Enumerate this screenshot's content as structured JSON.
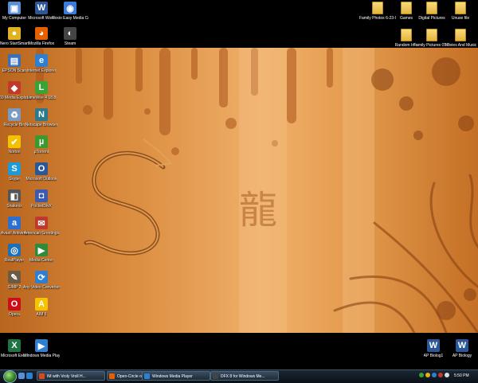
{
  "desktop": {
    "top_left_icons": [
      {
        "label": "My Computer",
        "icon": "computer-icon",
        "color": "#5a8fd6",
        "glyph": "▣"
      },
      {
        "label": "Microsoft Word",
        "icon": "word-icon",
        "color": "#2b5797",
        "glyph": "W"
      },
      {
        "label": "Roxio Easy Media Crea...",
        "icon": "roxio-icon",
        "color": "#3e7bd8",
        "glyph": "◉"
      },
      {
        "label": "Nero StartSmart",
        "icon": "nero-icon",
        "color": "#e1b21f",
        "glyph": "●"
      },
      {
        "label": "Mozilla Firefox",
        "icon": "firefox-icon",
        "color": "#e66000",
        "glyph": "◕"
      },
      {
        "label": "Steam",
        "icon": "steam-icon",
        "color": "#444444",
        "glyph": "◐"
      }
    ],
    "top_right_icons": [
      {
        "label": "Family Photos 6-23-07",
        "icon": "folder-icon"
      },
      {
        "label": "Games",
        "icon": "folder-icon"
      },
      {
        "label": "Digital Pictures",
        "icon": "folder-icon"
      },
      {
        "label": "Unuse file",
        "icon": "folder-icon"
      },
      {
        "label": "Random Info",
        "icon": "folder-icon"
      },
      {
        "label": "Family Pictures 07-08",
        "icon": "folder-icon"
      },
      {
        "label": "Movies And Music",
        "icon": "folder-icon"
      }
    ],
    "left_column_icons": [
      {
        "label": "EPSON Scan",
        "icon": "epson-icon",
        "color": "#3b6fb6",
        "glyph": "▤"
      },
      {
        "label": "Internet Explorer",
        "icon": "ie-icon",
        "color": "#2f7fd1",
        "glyph": "e"
      },
      {
        "label": "360 Media Explorer",
        "icon": "media-explorer-icon",
        "color": "#c0392b",
        "glyph": "◆"
      },
      {
        "label": "LimeWire 4.18.8",
        "icon": "limewire-icon",
        "color": "#3aa335",
        "glyph": "L"
      },
      {
        "label": "Recycle Bin",
        "icon": "recycle-bin-icon",
        "color": "#7a9bbf",
        "glyph": "♻"
      },
      {
        "label": "Netscape Browser",
        "icon": "netscape-icon",
        "color": "#2c7a8c",
        "glyph": "N"
      },
      {
        "label": "Norton",
        "icon": "norton-icon",
        "color": "#f2c200",
        "glyph": "✔"
      },
      {
        "label": "µTorrent",
        "icon": "utorrent-icon",
        "color": "#3a9a2d",
        "glyph": "µ"
      },
      {
        "label": "Skype",
        "icon": "skype-icon",
        "color": "#1e9ad6",
        "glyph": "S"
      },
      {
        "label": "Microsoft Outlook",
        "icon": "outlook-icon",
        "color": "#2b5797",
        "glyph": "O"
      },
      {
        "label": "Snakeox",
        "icon": "snakeox-icon",
        "color": "#555555",
        "glyph": "◧"
      },
      {
        "label": "PocketDivX",
        "icon": "pocketdivx-icon",
        "color": "#3b5bb0",
        "glyph": "◘"
      },
      {
        "label": "Avast! Antivirus",
        "icon": "avast-icon",
        "color": "#2a6fd1",
        "glyph": "a"
      },
      {
        "label": "American Greetings",
        "icon": "greetings-icon",
        "color": "#c0392b",
        "glyph": "✉"
      },
      {
        "label": "RealPlayer",
        "icon": "realplayer-icon",
        "color": "#1f6fb5",
        "glyph": "◎"
      },
      {
        "label": "Media Center",
        "icon": "media-center-icon",
        "color": "#2e8b3a",
        "glyph": "▶"
      },
      {
        "label": "GIMP 2",
        "icon": "gimp-icon",
        "color": "#6b5b45",
        "glyph": "✎"
      },
      {
        "label": "Any Video Converter",
        "icon": "video-converter-icon",
        "color": "#2f7fd1",
        "glyph": "⟳"
      },
      {
        "label": "Opera",
        "icon": "opera-icon",
        "color": "#cc0f16",
        "glyph": "O"
      },
      {
        "label": "AIM 6",
        "icon": "aim-icon",
        "color": "#f5c400",
        "glyph": "A"
      }
    ],
    "bottom_left_icons": [
      {
        "label": "Microsoft Excel",
        "icon": "excel-icon",
        "color": "#1f7244",
        "glyph": "X"
      },
      {
        "label": "Windows Media Player",
        "icon": "wmp-icon",
        "color": "#2f7fd1",
        "glyph": "▶"
      }
    ],
    "bottom_right_icons": [
      {
        "label": "AP Biolog1",
        "icon": "word-doc-icon",
        "color": "#2b5797",
        "glyph": "W"
      },
      {
        "label": "AP Biology",
        "icon": "word-doc-icon",
        "color": "#2b5797",
        "glyph": "W"
      }
    ],
    "wallpaper": {
      "character": "龍",
      "base_color": "#d98a3c"
    }
  },
  "taskbar": {
    "start_icon": "windows-orb-icon",
    "quick_launch": [
      {
        "icon": "show-desktop-icon",
        "color": "#5a8fd6"
      },
      {
        "icon": "ie-quicklaunch-icon",
        "color": "#2f7fd1"
      }
    ],
    "buttons": [
      {
        "label": "IM with Vroly Vroll H...",
        "icon": "aim-task-icon",
        "color": "#d64b1b"
      },
      {
        "label": "Open-Circle on devian...",
        "icon": "firefox-task-icon",
        "color": "#e66000"
      },
      {
        "label": "Windows Media Player",
        "icon": "wmp-task-icon",
        "color": "#2f7fd1"
      },
      {
        "label": "DFX 8 for Windows Me...",
        "icon": "dfx-task-icon",
        "color": "#444444"
      }
    ],
    "clock": "5:50 PM"
  }
}
